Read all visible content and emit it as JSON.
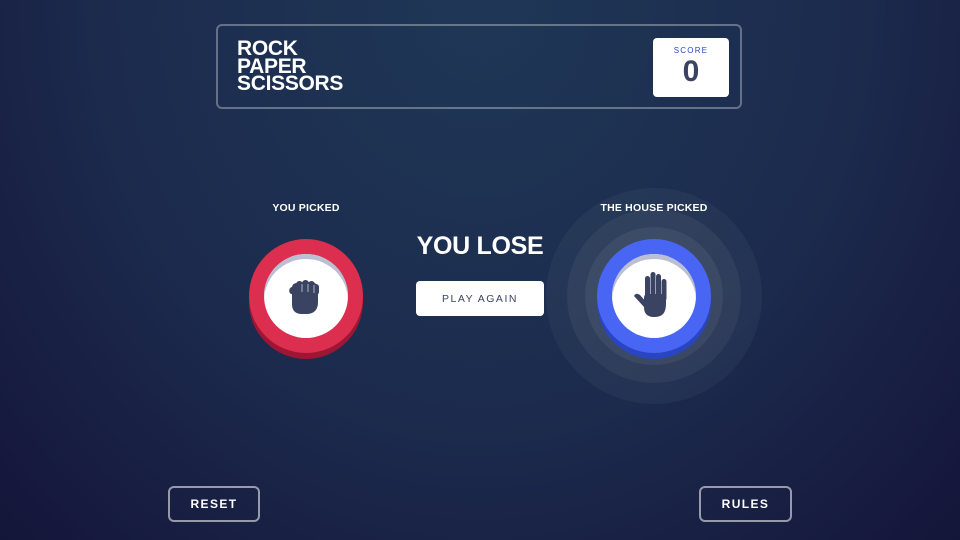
{
  "header": {
    "title_lines": [
      "Rock",
      "Paper",
      "Scissors"
    ],
    "score_label": "Score",
    "score_value": "0"
  },
  "player": {
    "label": "You Picked",
    "choice": "rock",
    "icon": "fist-icon",
    "color": "#dc2e4e"
  },
  "house": {
    "label": "The House Picked",
    "choice": "paper",
    "icon": "open-hand-icon",
    "color": "#4865f4"
  },
  "result": {
    "text": "YOU LOSE",
    "play_again_label": "PLAY AGAIN"
  },
  "footer": {
    "reset_label": "RESET",
    "rules_label": "RULES"
  }
}
